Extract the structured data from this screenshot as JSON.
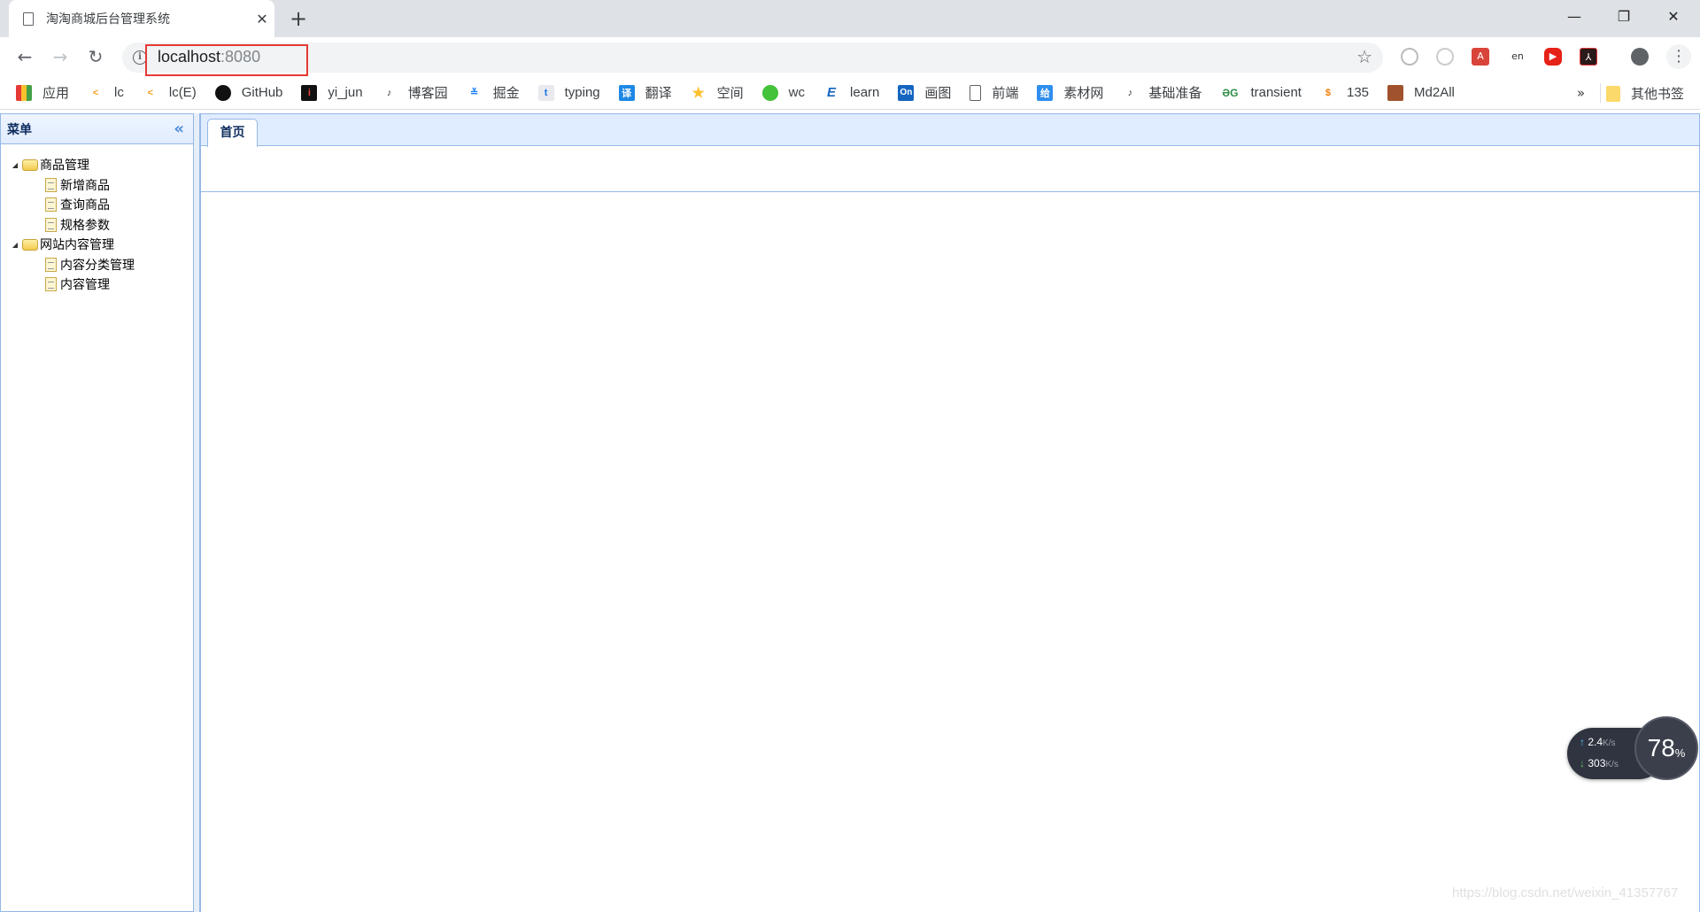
{
  "browser": {
    "tab_title": "淘淘商城后台管理系统",
    "new_tab_label": "+",
    "url_host": "localhost",
    "url_port": ":8080",
    "window_controls": [
      "minimize",
      "restore",
      "close"
    ]
  },
  "bookmarks": {
    "items": [
      {
        "label": "应用",
        "icon": "apps-grid-icon"
      },
      {
        "label": "lc",
        "icon": "leetcode-icon"
      },
      {
        "label": "lc(E)",
        "icon": "leetcode-icon"
      },
      {
        "label": "GitHub",
        "icon": "github-icon"
      },
      {
        "label": "yi_jun",
        "icon": "yijun-icon"
      },
      {
        "label": "博客园",
        "icon": "cnblogs-icon"
      },
      {
        "label": "掘金",
        "icon": "juejin-icon"
      },
      {
        "label": "typing",
        "icon": "typing-icon"
      },
      {
        "label": "翻译",
        "icon": "translate-icon"
      },
      {
        "label": "空间",
        "icon": "qzone-star-icon"
      },
      {
        "label": "wc",
        "icon": "wechat-icon"
      },
      {
        "label": "learn",
        "icon": "learn-icon"
      },
      {
        "label": "画图",
        "icon": "onedraw-icon"
      },
      {
        "label": "前端",
        "icon": "page-icon"
      },
      {
        "label": "素材网",
        "icon": "sucai-icon"
      },
      {
        "label": "基础准备",
        "icon": "cnblogs-icon"
      },
      {
        "label": "transient",
        "icon": "geeksforgeeks-icon"
      },
      {
        "label": "135",
        "icon": "135-icon"
      },
      {
        "label": "Md2All",
        "icon": "md2all-avatar-icon"
      }
    ],
    "more_label": "»",
    "other_label": "其他书签"
  },
  "menu": {
    "title": "菜单",
    "tree": [
      {
        "label": "商品管理",
        "children": [
          "新增商品",
          "查询商品",
          "规格参数"
        ]
      },
      {
        "label": "网站内容管理",
        "children": [
          "内容分类管理",
          "内容管理"
        ]
      }
    ]
  },
  "tabs": [
    {
      "label": "首页"
    }
  ],
  "netspeed": {
    "upload": "2.4",
    "upload_unit": "K/s",
    "download": "303",
    "download_unit": "K/s",
    "usage_percent": "78",
    "percent_sign": "%"
  },
  "watermark": "https://blog.csdn.net/weixin_41357767"
}
